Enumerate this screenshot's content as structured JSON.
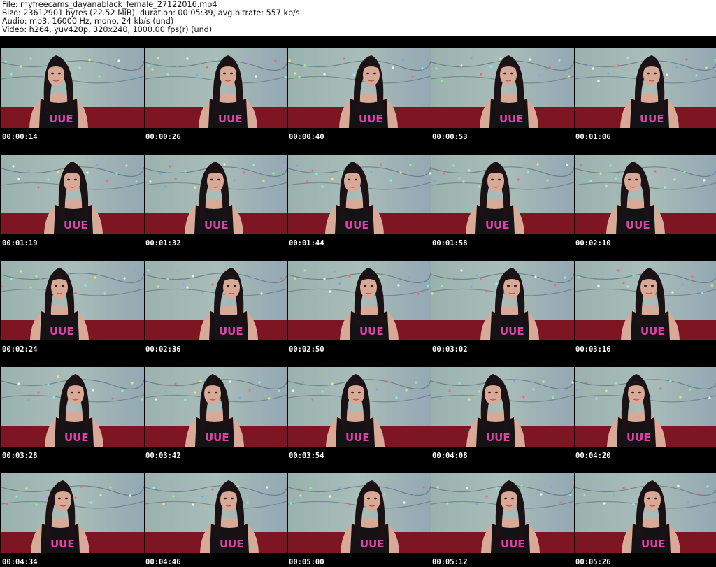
{
  "header": {
    "file_line": "File: myfreecams_dayanablack_female_27122016.mp4",
    "size_line": "Size: 23612901 bytes (22.52 MiB), duration: 00:05:39, avg.bitrate: 557 kb/s",
    "audio_line": "Audio: mp3, 16000 Hz, mono, 24 kb/s (und)",
    "video_line": "Video: h264, yuv420p, 320x240, 1000.00 fps(r) (und)"
  },
  "frames": [
    {
      "time": "00:00:14"
    },
    {
      "time": "00:00:26"
    },
    {
      "time": "00:00:40"
    },
    {
      "time": "00:00:53"
    },
    {
      "time": "00:01:06"
    },
    {
      "time": "00:01:19"
    },
    {
      "time": "00:01:32"
    },
    {
      "time": "00:01:44"
    },
    {
      "time": "00:01:58"
    },
    {
      "time": "00:02:10"
    },
    {
      "time": "00:02:24"
    },
    {
      "time": "00:02:36"
    },
    {
      "time": "00:02:50"
    },
    {
      "time": "00:03:02"
    },
    {
      "time": "00:03:16"
    },
    {
      "time": "00:03:28"
    },
    {
      "time": "00:03:42"
    },
    {
      "time": "00:03:54"
    },
    {
      "time": "00:04:08"
    },
    {
      "time": "00:04:20"
    },
    {
      "time": "00:04:34"
    },
    {
      "time": "00:04:46"
    },
    {
      "time": "00:05:00"
    },
    {
      "time": "00:05:12"
    },
    {
      "time": "00:05:26"
    }
  ],
  "colors": {
    "wall": "#a9bdb9",
    "couch": "#7d1522",
    "hair": "#1a1214",
    "skin": "#d8a996",
    "top": "#141214",
    "print": "#e040a8"
  }
}
